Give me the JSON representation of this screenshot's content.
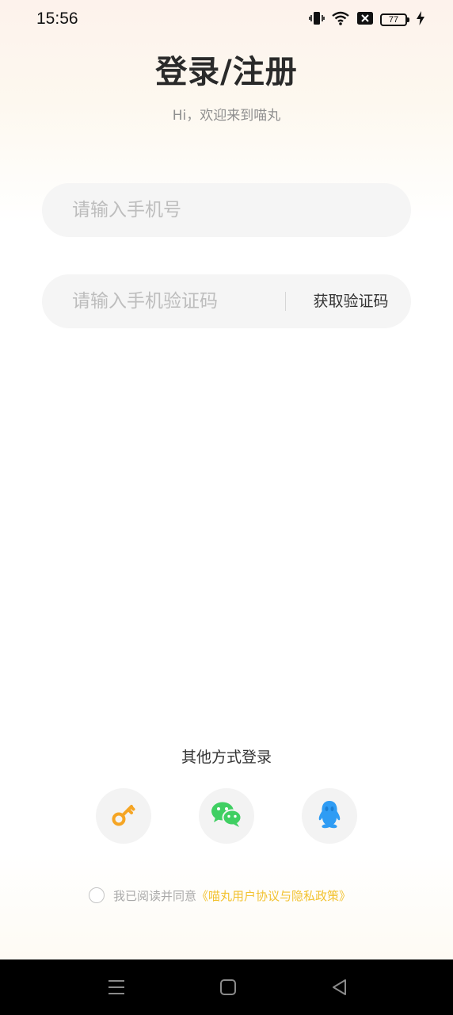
{
  "status_bar": {
    "time": "15:56",
    "battery": "77",
    "icons": [
      "vibrate-icon",
      "wifi-icon",
      "no-sim-icon",
      "battery-icon",
      "charging-icon"
    ]
  },
  "header": {
    "title": "登录/注册",
    "subtitle": "Hi，欢迎来到喵丸"
  },
  "form": {
    "phone_placeholder": "请输入手机号",
    "code_placeholder": "请输入手机验证码",
    "get_code_label": "获取验证码"
  },
  "other_login": {
    "title": "其他方式登录",
    "options": [
      {
        "icon": "key-icon",
        "color": "#f5a524"
      },
      {
        "icon": "wechat-icon",
        "color": "#3fcf62"
      },
      {
        "icon": "qq-icon",
        "color": "#2f9cf4"
      }
    ]
  },
  "agreement": {
    "text": "我已阅读并同意",
    "link": "《喵丸用户协议与隐私政策》"
  },
  "colors": {
    "accent": "#f2c230",
    "title": "#2a2a2a"
  },
  "nav_bar": {
    "buttons": [
      "menu-icon",
      "home-icon",
      "back-icon"
    ]
  }
}
